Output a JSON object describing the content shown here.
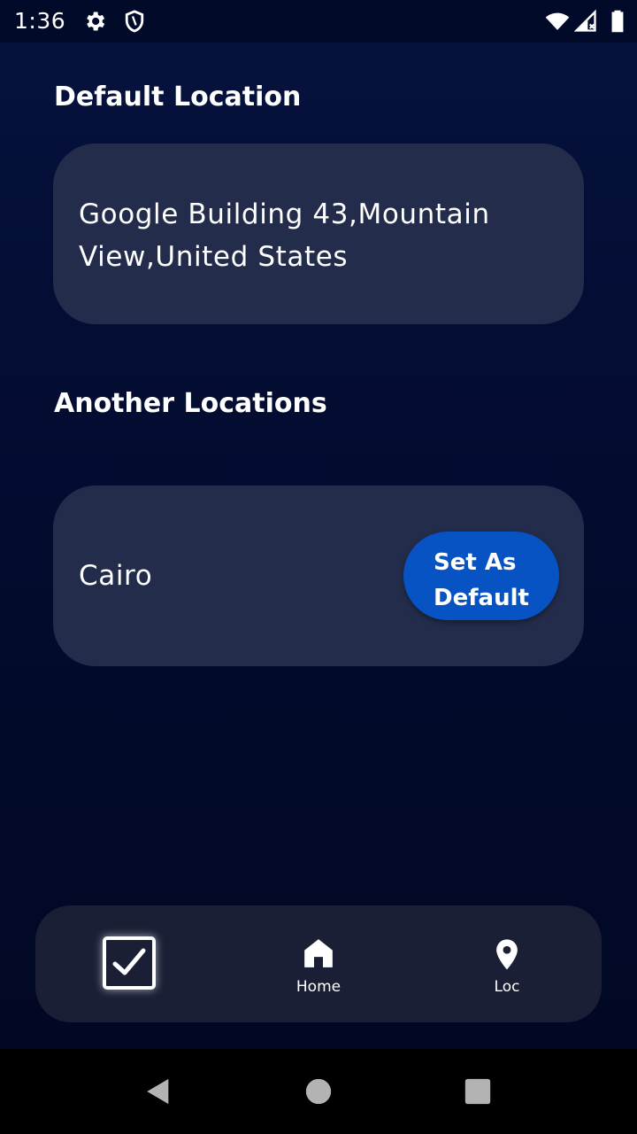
{
  "status_bar": {
    "time": "1:36",
    "icons": [
      "gear-icon",
      "shield-icon",
      "wifi-icon",
      "cellular-signal-icon",
      "battery-icon"
    ]
  },
  "default_location": {
    "title": "Default Location",
    "address": "Google Building 43,Mountain View,United States"
  },
  "other_locations": {
    "title": "Another Locations",
    "items": [
      {
        "name": "Cairo",
        "action_label": "Set As Default"
      }
    ]
  },
  "bottom_nav": {
    "items": [
      {
        "icon": "checkbox-icon",
        "label": ""
      },
      {
        "icon": "home-icon",
        "label": "Home"
      },
      {
        "icon": "location-pin-icon",
        "label": "Loc"
      }
    ]
  },
  "system_nav": {
    "icons": [
      "back-icon",
      "home-circle-icon",
      "recents-icon"
    ]
  },
  "colors": {
    "background": "#040d33",
    "card": "#232c4a",
    "button": "#0753c4",
    "nav_bar": "#1a1f36"
  }
}
